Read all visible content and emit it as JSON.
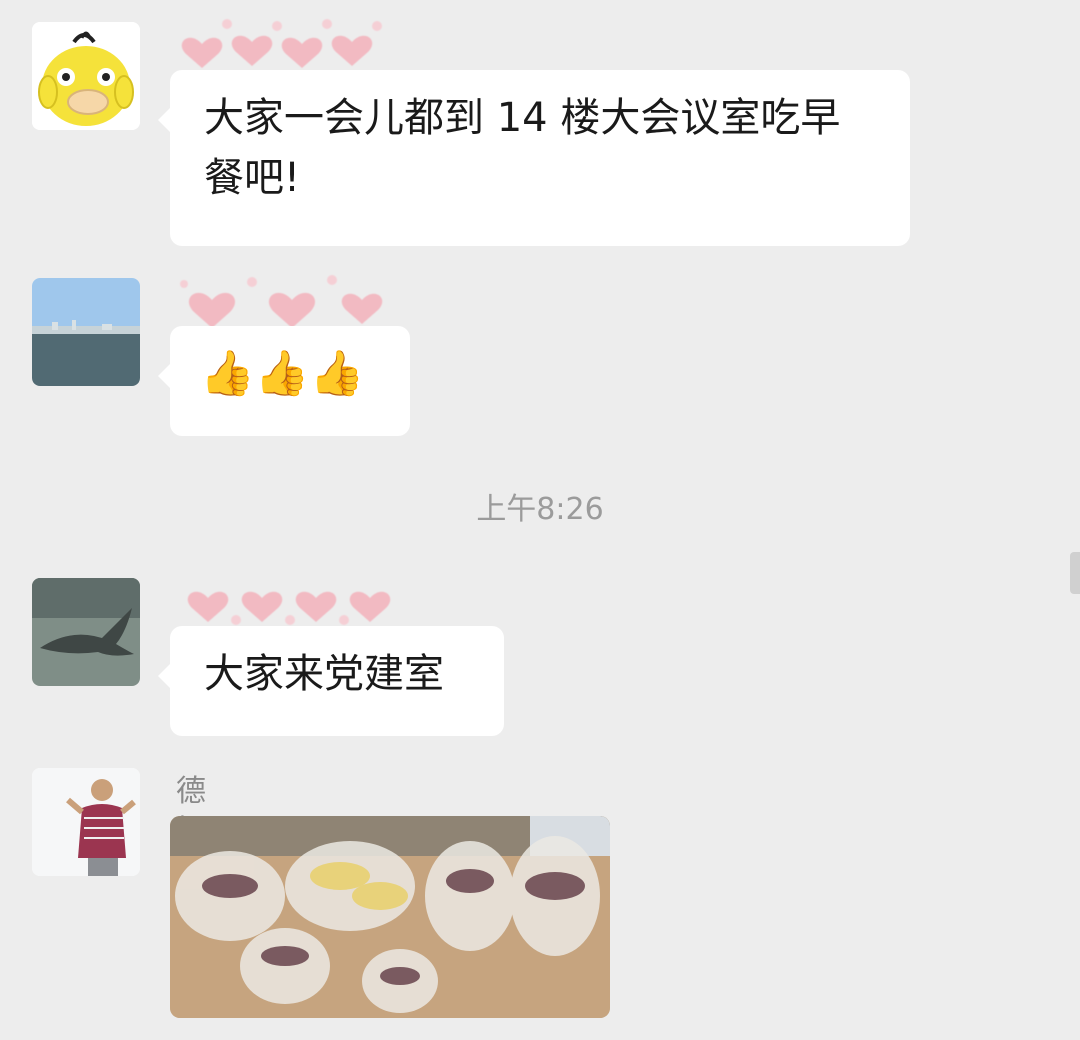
{
  "messages": [
    {
      "avatar_icon": "yellow-duck-avatar",
      "text": "大家一会儿都到 14 楼大会议室吃早餐吧!"
    },
    {
      "avatar_icon": "sea-view-avatar",
      "text": "👍👍👍"
    },
    {
      "avatar_icon": "bird-photo-avatar",
      "text": "大家来党建室"
    },
    {
      "avatar_icon": "person-photo-avatar",
      "sender": "德恒-王建新",
      "image_icon": "breakfast-bags-photo"
    }
  ],
  "timestamp": "上午8:26",
  "colors": {
    "background": "#ededed",
    "bubble": "#ffffff",
    "timestamp_text": "#9b9b9b",
    "sender_text": "#8a8a8a"
  }
}
